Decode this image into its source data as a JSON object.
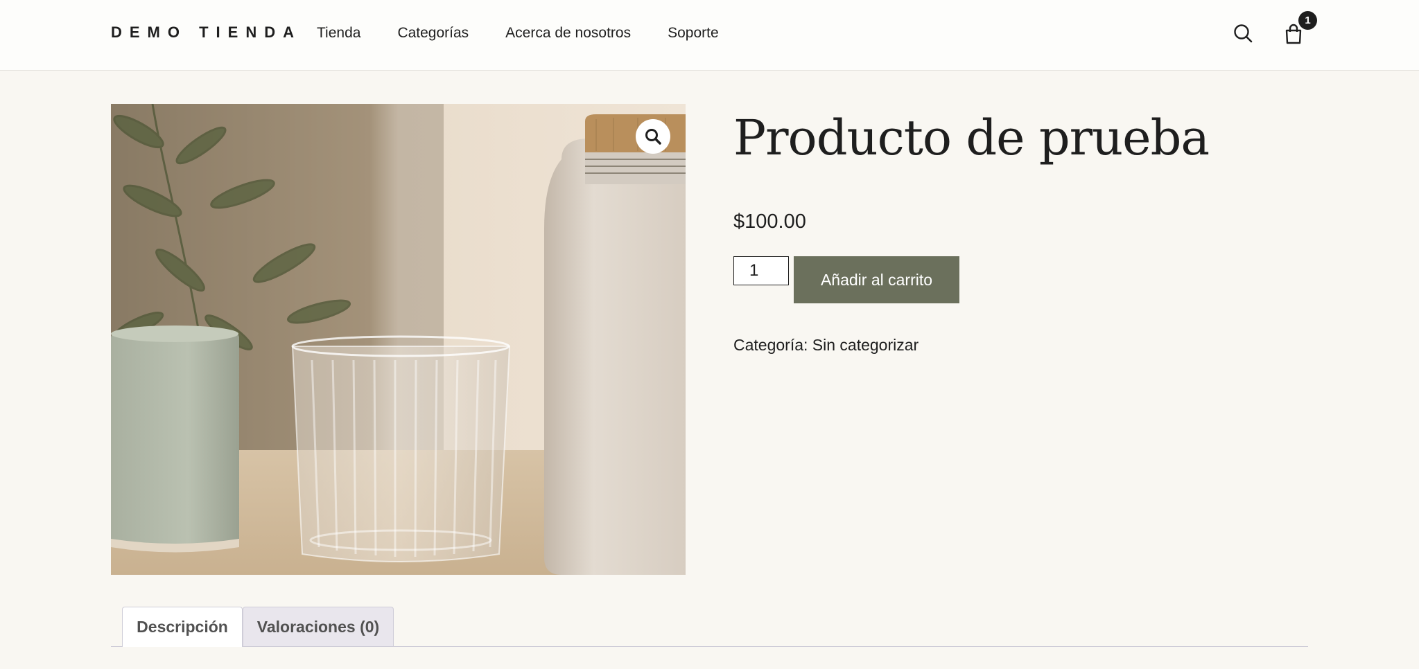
{
  "header": {
    "logo": "DEMO TIENDA",
    "nav": [
      "Tienda",
      "Categorías",
      "Acerca de nosotros",
      "Soporte"
    ],
    "cart_count": "1",
    "icons": [
      "search-icon",
      "cart-icon"
    ]
  },
  "product": {
    "title": "Producto de prueba",
    "price": "$100.00",
    "quantity": "1",
    "add_to_cart_label": "Añadir al carrito",
    "category_text": "Categoría: Sin categorizar"
  },
  "tabs": [
    {
      "label": "Descripción",
      "active": true
    },
    {
      "label": "Valoraciones (0)",
      "active": false
    }
  ],
  "colors": {
    "background": "#f9f7f2",
    "header_background": "#fdfdfb",
    "button_background": "#6b705c",
    "text": "#1e1e1e"
  }
}
